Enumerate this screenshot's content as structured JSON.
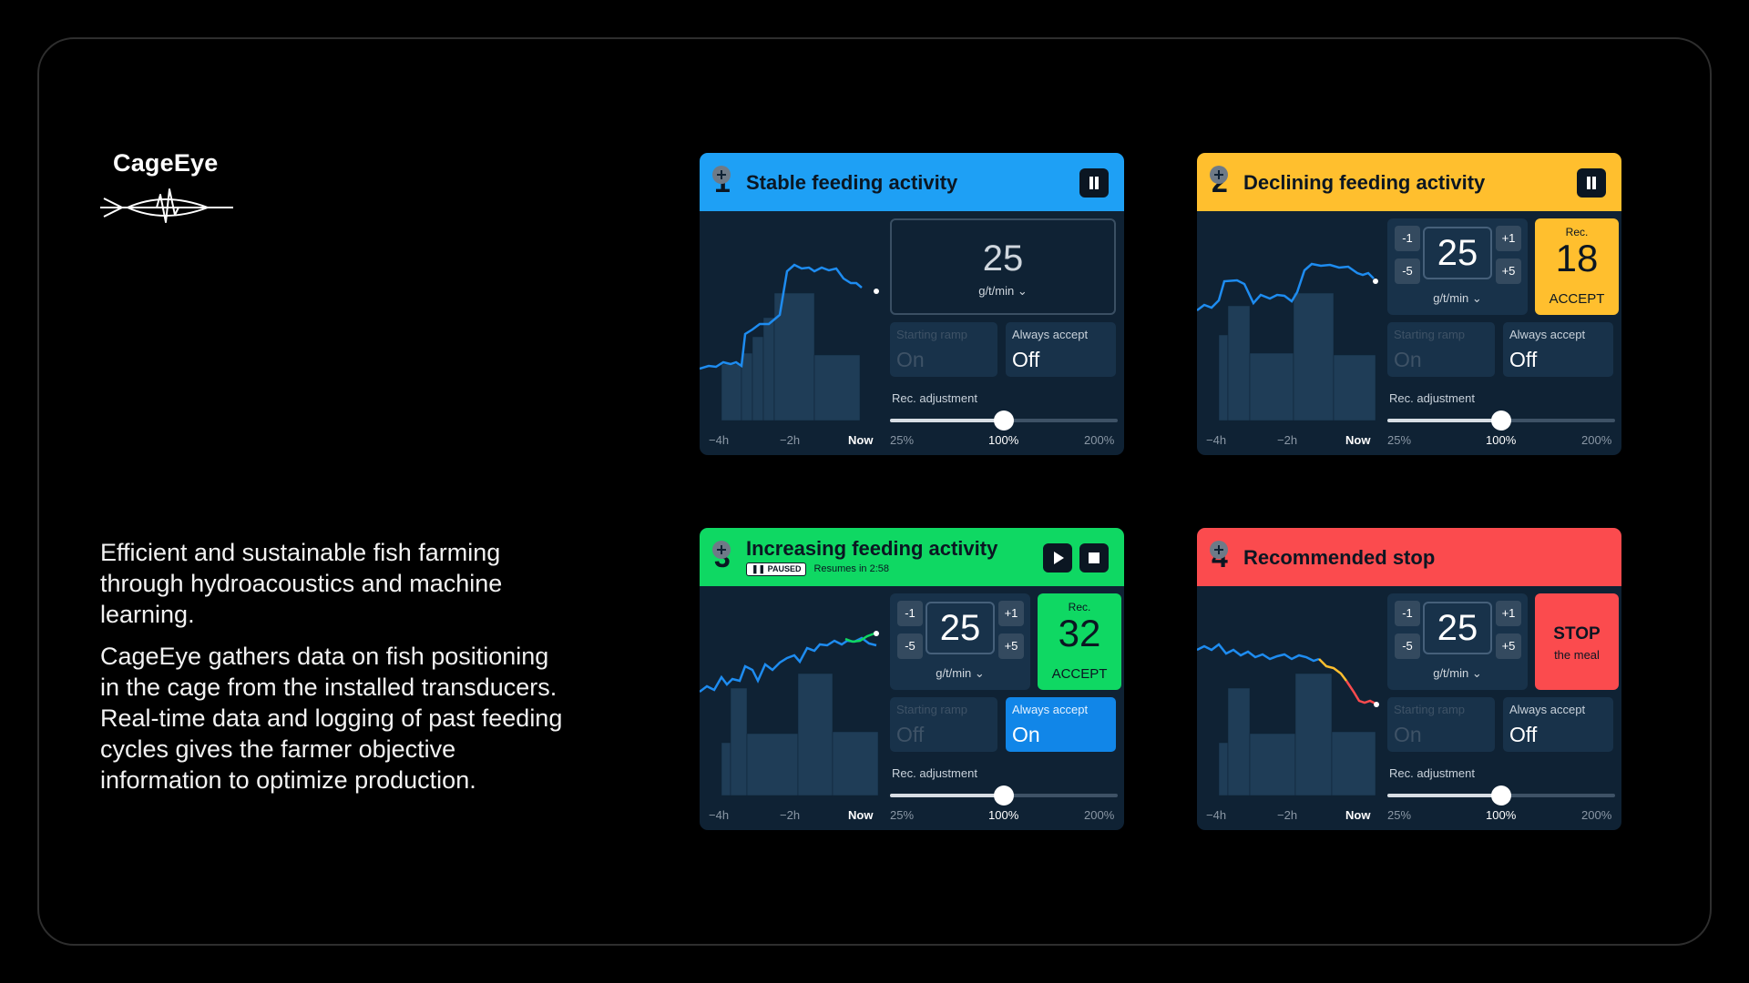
{
  "brand": {
    "name": "CageEye",
    "logo_icon": "fish-waveform-icon"
  },
  "description": {
    "p1": "Efficient and sustainable fish farming through hydroacoustics and machine learning.",
    "p2": "CageEye gathers data on fish positioning in the cage from the installed transducers. Real-time data and logging of past feeding cycles gives the farmer objective information to optimize production."
  },
  "colors": {
    "blue": "#1ea0f5",
    "yellow": "#ffbf2e",
    "green": "#0fd863",
    "red": "#fb4b4e",
    "panel": "#0f2234"
  },
  "cards": [
    {
      "number": "1",
      "title": "Stable feeding activity",
      "header_color": "#1ea0f5",
      "value": "25",
      "unit": "g/t/min",
      "starting_ramp": {
        "label": "Starting ramp",
        "value": "On"
      },
      "always_accept": {
        "label": "Always accept",
        "value": "Off"
      },
      "rec_adjustment": "Rec. adjustment",
      "time_ticks": [
        "−4h",
        "−2h",
        "Now"
      ],
      "slider": {
        "min": "25%",
        "current": "100%",
        "max": "200%",
        "value_percent": 100
      }
    },
    {
      "number": "2",
      "title": "Declining feeding activity",
      "header_color": "#ffbf2e",
      "value": "25",
      "unit": "g/t/min",
      "steps": {
        "minus1": "-1",
        "minus5": "-5",
        "plus1": "+1",
        "plus5": "+5"
      },
      "rec": {
        "label": "Rec.",
        "value": "18",
        "action": "ACCEPT",
        "color": "#ffbf2e"
      },
      "starting_ramp": {
        "label": "Starting ramp",
        "value": "On"
      },
      "always_accept": {
        "label": "Always accept",
        "value": "Off"
      },
      "rec_adjustment": "Rec. adjustment",
      "time_ticks": [
        "−4h",
        "−2h",
        "Now"
      ],
      "slider": {
        "min": "25%",
        "current": "100%",
        "max": "200%",
        "value_percent": 100
      }
    },
    {
      "number": "3",
      "title": "Increasing feeding activity",
      "header_color": "#0fd863",
      "paused": "PAUSED",
      "resumes": "Resumes in 2:58",
      "value": "25",
      "unit": "g/t/min",
      "steps": {
        "minus1": "-1",
        "minus5": "-5",
        "plus1": "+1",
        "plus5": "+5"
      },
      "rec": {
        "label": "Rec.",
        "value": "32",
        "action": "ACCEPT",
        "color": "#0fd863"
      },
      "starting_ramp": {
        "label": "Starting ramp",
        "value": "Off"
      },
      "always_accept": {
        "label": "Always accept",
        "value": "On"
      },
      "rec_adjustment": "Rec. adjustment",
      "time_ticks": [
        "−4h",
        "−2h",
        "Now"
      ],
      "slider": {
        "min": "25%",
        "current": "100%",
        "max": "200%",
        "value_percent": 100
      }
    },
    {
      "number": "4",
      "title": "Recommended stop",
      "header_color": "#fb4b4e",
      "value": "25",
      "unit": "g/t/min",
      "steps": {
        "minus1": "-1",
        "minus5": "-5",
        "plus1": "+1",
        "plus5": "+5"
      },
      "rec": {
        "stop": "STOP",
        "sub": "the meal",
        "color": "#fb4b4e"
      },
      "starting_ramp": {
        "label": "Starting ramp",
        "value": "On"
      },
      "always_accept": {
        "label": "Always accept",
        "value": "Off"
      },
      "rec_adjustment": "Rec. adjustment",
      "time_ticks": [
        "−4h",
        "−2h",
        "Now"
      ],
      "slider": {
        "min": "25%",
        "current": "100%",
        "max": "200%",
        "value_percent": 100
      }
    }
  ]
}
